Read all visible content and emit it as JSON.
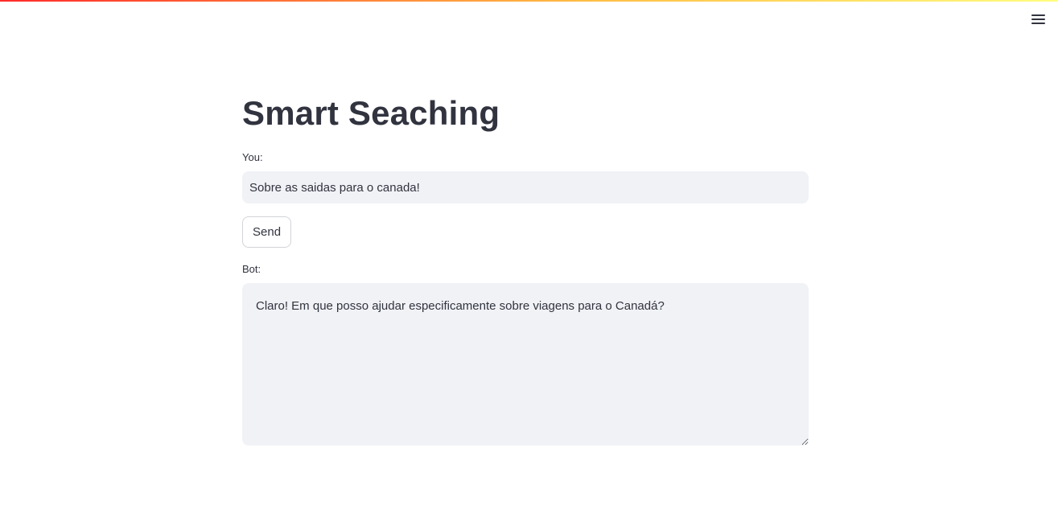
{
  "app": {
    "title": "Smart Seaching"
  },
  "header": {
    "menu_icon": "hamburger-menu-icon",
    "decoration_colors": [
      "#ff2b2b",
      "#ffbd45",
      "#fffd80"
    ]
  },
  "chat": {
    "user_label": "You:",
    "user_input_value": "Sobre as saidas para o canada!",
    "send_label": "Send",
    "bot_label": "Bot:",
    "bot_response": "Claro! Em que posso ajudar especificamente sobre viagens para o Canadá?"
  },
  "colors": {
    "text": "#31333f",
    "input_background": "#f0f2f6",
    "button_border": "#d3d4d9"
  }
}
